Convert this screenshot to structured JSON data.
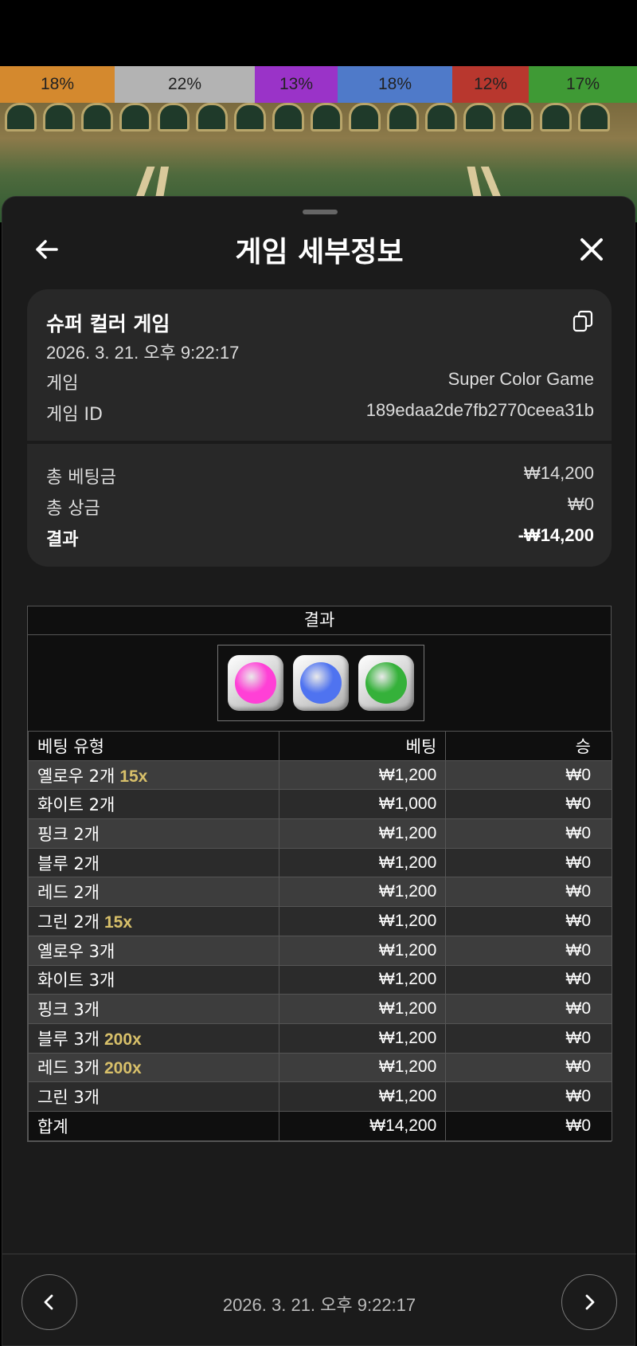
{
  "percent_bar": [
    {
      "label": "18%",
      "color": "#d4892e",
      "fraction": 0.18
    },
    {
      "label": "22%",
      "color": "#b3b3b3",
      "fraction": 0.22
    },
    {
      "label": "13%",
      "color": "#9a33c8",
      "fraction": 0.13
    },
    {
      "label": "18%",
      "color": "#4f7ac9",
      "fraction": 0.18
    },
    {
      "label": "12%",
      "color": "#b8372e",
      "fraction": 0.12
    },
    {
      "label": "17%",
      "color": "#3f9a35",
      "fraction": 0.17
    }
  ],
  "header": {
    "title": "게임 세부정보",
    "back_icon": "arrow-left-icon",
    "close_icon": "close-icon"
  },
  "summary": {
    "game_name": "슈퍼 컬러 게임",
    "date": "2026. 3. 21. 오후 9:22:17",
    "copy_icon": "copy-icon",
    "game_label": "게임",
    "game_value": "Super Color Game",
    "id_label": "게임 ID",
    "id_value": "189edaa2de7fb2770ceea31b",
    "total_bet_label": "총 베팅금",
    "total_bet_value": "₩14,200",
    "total_prize_label": "총 상금",
    "total_prize_value": "₩0",
    "result_label": "결과",
    "result_value": "-₩14,200"
  },
  "result_section": {
    "title": "결과",
    "balls": [
      {
        "color": "#ff40d6",
        "name": "pink-ball"
      },
      {
        "color": "#4f73f0",
        "name": "blue-ball"
      },
      {
        "color": "#35b13a",
        "name": "green-ball"
      }
    ]
  },
  "bets_table": {
    "headers": [
      "베팅 유형",
      "베팅",
      "승"
    ],
    "rows": [
      {
        "type": "옐로우 2개",
        "mult": "15x",
        "bet": "₩1,200",
        "win": "₩0"
      },
      {
        "type": "화이트 2개",
        "mult": "",
        "bet": "₩1,000",
        "win": "₩0"
      },
      {
        "type": "핑크 2개",
        "mult": "",
        "bet": "₩1,200",
        "win": "₩0"
      },
      {
        "type": "블루 2개",
        "mult": "",
        "bet": "₩1,200",
        "win": "₩0"
      },
      {
        "type": "레드 2개",
        "mult": "",
        "bet": "₩1,200",
        "win": "₩0"
      },
      {
        "type": "그린 2개",
        "mult": "15x",
        "bet": "₩1,200",
        "win": "₩0"
      },
      {
        "type": "옐로우 3개",
        "mult": "",
        "bet": "₩1,200",
        "win": "₩0"
      },
      {
        "type": "화이트 3개",
        "mult": "",
        "bet": "₩1,200",
        "win": "₩0"
      },
      {
        "type": "핑크 3개",
        "mult": "",
        "bet": "₩1,200",
        "win": "₩0"
      },
      {
        "type": "블루 3개",
        "mult": "200x",
        "bet": "₩1,200",
        "win": "₩0"
      },
      {
        "type": "레드 3개",
        "mult": "200x",
        "bet": "₩1,200",
        "win": "₩0"
      },
      {
        "type": "그린 3개",
        "mult": "",
        "bet": "₩1,200",
        "win": "₩0"
      }
    ],
    "total": {
      "type": "합계",
      "bet": "₩14,200",
      "win": "₩0"
    }
  },
  "footer": {
    "date": "2026. 3. 21. 오후 9:22:17",
    "prev_icon": "chevron-left-icon",
    "next_icon": "chevron-right-icon"
  }
}
